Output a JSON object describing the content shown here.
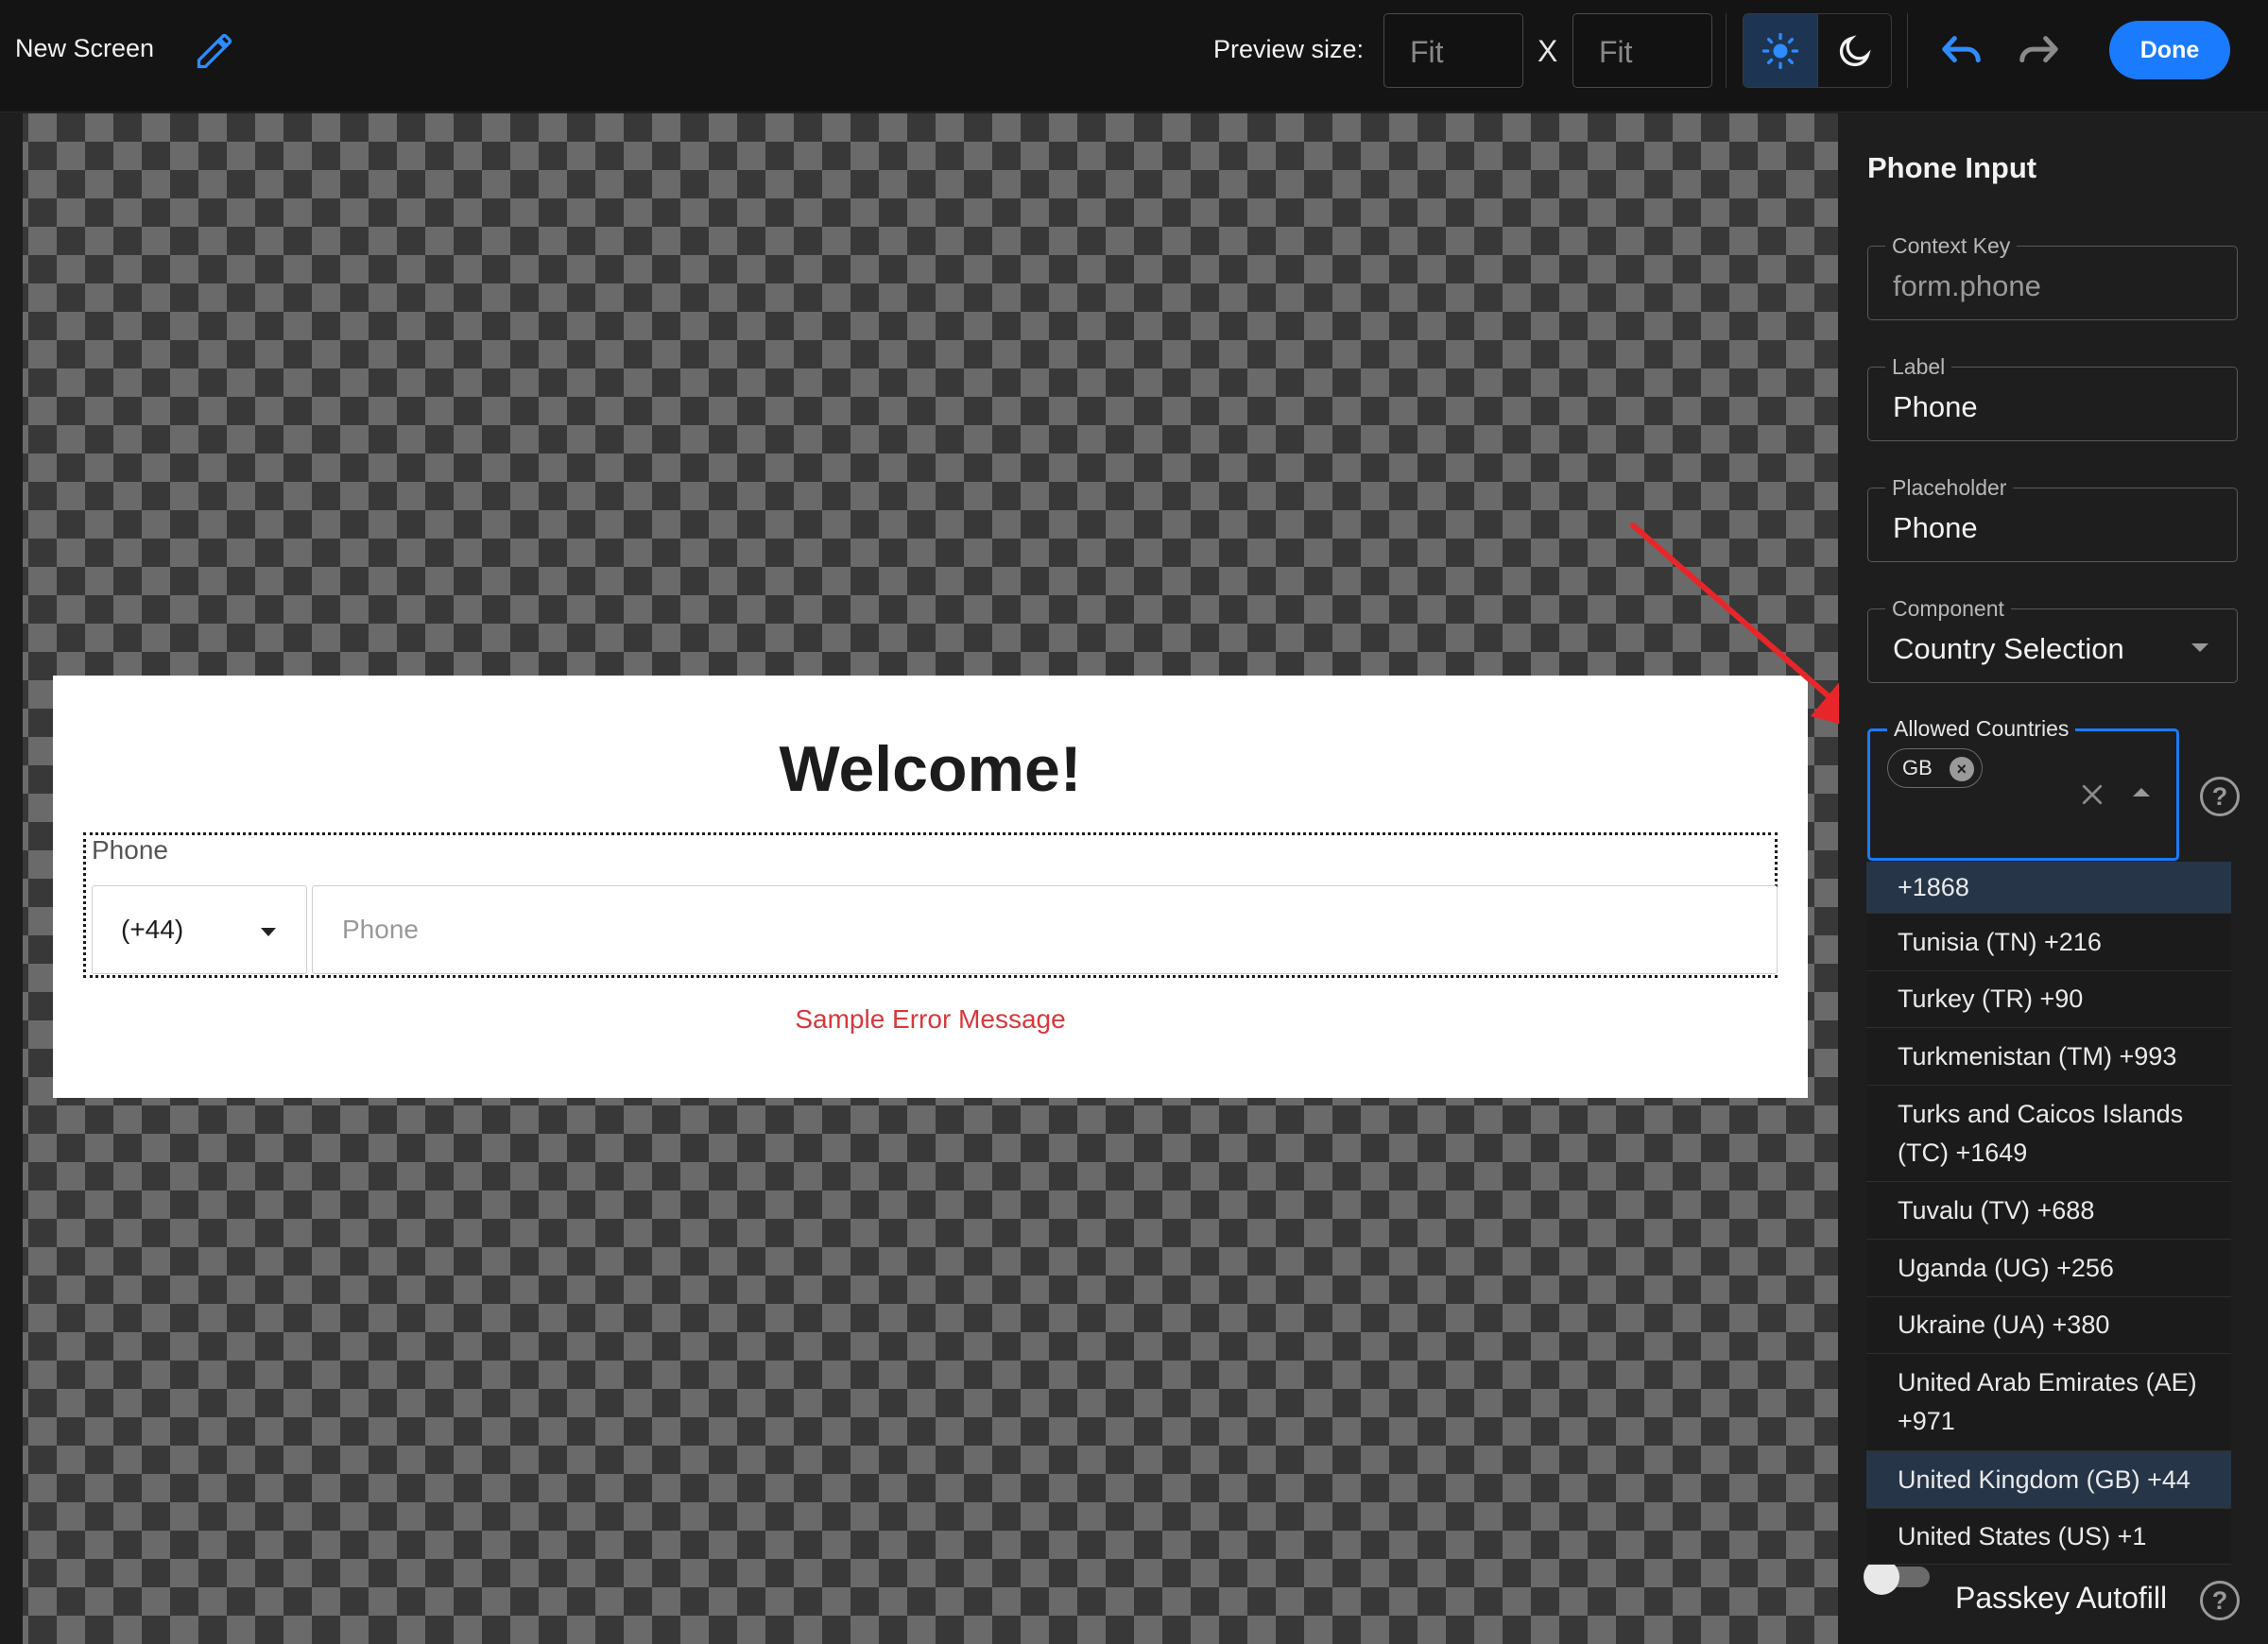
{
  "topbar": {
    "title": "New Screen",
    "preview_label": "Preview size:",
    "width_value": "Fit",
    "separator": "X",
    "height_value": "Fit",
    "done_label": "Done"
  },
  "preview": {
    "heading": "Welcome!",
    "phone_label": "Phone",
    "dial_code": "(+44)",
    "phone_placeholder": "Phone",
    "error_message": "Sample Error Message"
  },
  "panel": {
    "title": "Phone Input",
    "context_key": {
      "label": "Context Key",
      "value": "form.phone"
    },
    "label_field": {
      "label": "Label",
      "value": "Phone"
    },
    "placeholder_field": {
      "label": "Placeholder",
      "value": "Phone"
    },
    "component_field": {
      "label": "Component",
      "value": "Country Selection"
    },
    "allowed_countries": {
      "label": "Allowed Countries",
      "chips": [
        "GB"
      ]
    },
    "help_glyph": "?",
    "chip_remove_glyph": "×",
    "passkey_label": "Passkey Autofill"
  },
  "dropdown": {
    "items": [
      {
        "label": "+1868",
        "highlighted": true
      },
      {
        "label": "Tunisia (TN) +216",
        "highlighted": false
      },
      {
        "label": "Turkey (TR) +90",
        "highlighted": false
      },
      {
        "label": "Turkmenistan (TM) +993",
        "highlighted": false
      },
      {
        "label": "Turks and Caicos Islands (TC) +1649",
        "highlighted": false
      },
      {
        "label": "Tuvalu (TV) +688",
        "highlighted": false
      },
      {
        "label": "Uganda (UG) +256",
        "highlighted": false
      },
      {
        "label": "Ukraine (UA) +380",
        "highlighted": false
      },
      {
        "label": "United Arab Emirates (AE) +971",
        "highlighted": false
      },
      {
        "label": "United Kingdom (GB) +44",
        "highlighted": true
      },
      {
        "label": "United States (US) +1",
        "highlighted": false
      }
    ]
  },
  "colors": {
    "accent": "#1a7bff",
    "error": "#d8383c",
    "arrow": "#e8262a"
  },
  "icons": [
    "pencil-icon",
    "sun-icon",
    "moon-icon",
    "undo-icon",
    "redo-icon",
    "close-icon",
    "caret-down-icon",
    "caret-up-icon",
    "help-icon"
  ]
}
